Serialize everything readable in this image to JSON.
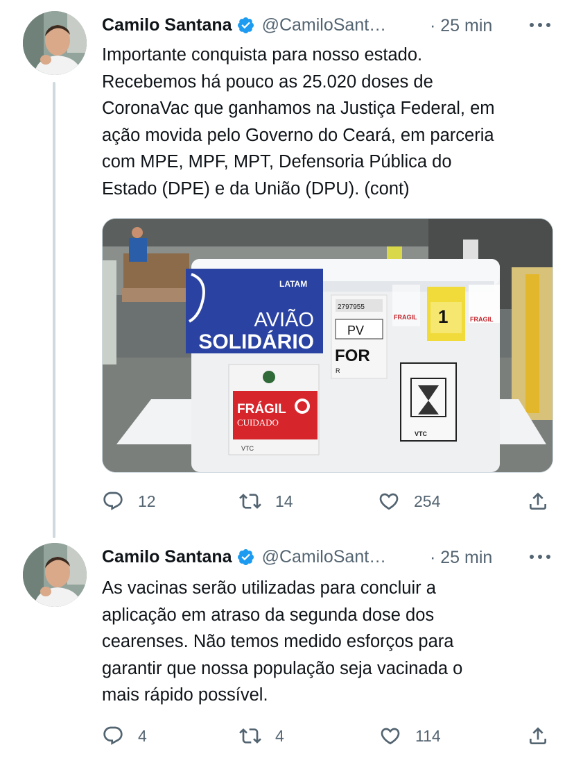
{
  "tweets": [
    {
      "author_name": "Camilo Santana",
      "handle": "@CamiloSant…",
      "time": "· 25 min",
      "text_lines": [
        "Importante conquista para nosso estado.",
        "Recebemos há pouco as 25.020 doses de",
        "CoronaVac que ganhamos na Justiça Federal, em",
        "ação movida pelo Governo do Ceará, em parceria",
        "com MPE, MPF, MPT, Defensoria Pública do",
        "Estado (DPE) e da União (DPU). (cont)"
      ],
      "media": {
        "brand_label": "LATAM",
        "title_line1": "AVIÃO",
        "title_line2": "SOLIDÁRIO",
        "tag_number": "2797955",
        "tag_code": "PV",
        "tag_dest": "FOR",
        "tag_letter": "R",
        "seq_label": "1",
        "fragile_line1": "FRÁGIL",
        "fragile_line2": "CUIDADO",
        "sticker_text": "FRAGIL",
        "vtc_label": "VTC"
      },
      "replies": "12",
      "retweets": "14",
      "likes": "254"
    },
    {
      "author_name": "Camilo Santana",
      "handle": "@CamiloSant…",
      "time": "· 25 min",
      "text_lines": [
        "As vacinas serão utilizadas para concluir a",
        "aplicação em atraso da segunda dose dos",
        "cearenses. Não temos medido esforços para",
        "garantir que nossa população seja vacinada o",
        "mais rápido possível."
      ],
      "replies": "4",
      "retweets": "4",
      "likes": "114"
    }
  ],
  "colors": {
    "verified": "#1d9bf0",
    "secondary_text": "#536471",
    "primary_text": "#0f1419",
    "thread_line": "#cfd9de"
  },
  "icons": [
    "verified-badge-icon",
    "more-icon",
    "reply-icon",
    "retweet-icon",
    "like-icon",
    "share-icon"
  ]
}
